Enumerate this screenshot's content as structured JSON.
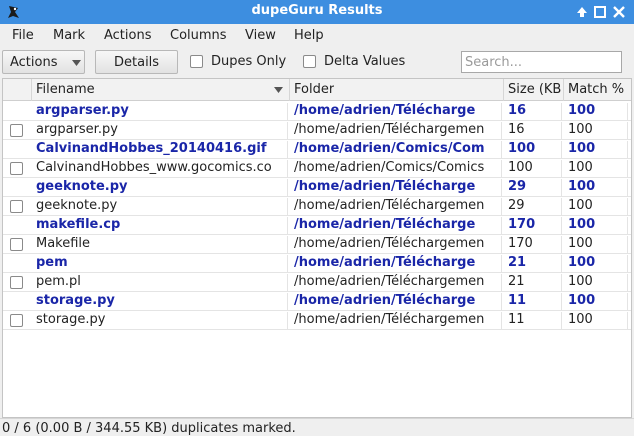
{
  "window": {
    "title": "dupeGuru Results"
  },
  "menu": [
    "File",
    "Mark",
    "Actions",
    "Columns",
    "View",
    "Help"
  ],
  "toolbar": {
    "actions_label": "Actions",
    "details_label": "Details",
    "dupes_only_label": "Dupes Only",
    "delta_values_label": "Delta Values",
    "search_placeholder": "Search..."
  },
  "table": {
    "columns": [
      "Filename",
      "Folder",
      "Size (KB",
      "Match %"
    ],
    "rows": [
      {
        "ref": true,
        "filename": "argparser.py",
        "folder": "/home/adrien/Télécharge",
        "size": "16",
        "match": "100"
      },
      {
        "ref": false,
        "filename": "argparser.py",
        "folder": "/home/adrien/Téléchargemen",
        "size": "16",
        "match": "100"
      },
      {
        "ref": true,
        "filename": "CalvinandHobbes_20140416.gif",
        "folder": "/home/adrien/Comics/Com",
        "size": "100",
        "match": "100"
      },
      {
        "ref": false,
        "filename": "CalvinandHobbes_www.gocomics.co",
        "folder": "/home/adrien/Comics/Comics",
        "size": "100",
        "match": "100"
      },
      {
        "ref": true,
        "filename": "geeknote.py",
        "folder": "/home/adrien/Télécharge",
        "size": "29",
        "match": "100"
      },
      {
        "ref": false,
        "filename": "geeknote.py",
        "folder": "/home/adrien/Téléchargemen",
        "size": "29",
        "match": "100"
      },
      {
        "ref": true,
        "filename": "makefile.cp",
        "folder": "/home/adrien/Télécharge",
        "size": "170",
        "match": "100"
      },
      {
        "ref": false,
        "filename": "Makefile",
        "folder": "/home/adrien/Téléchargemen",
        "size": "170",
        "match": "100"
      },
      {
        "ref": true,
        "filename": "pem",
        "folder": "/home/adrien/Télécharge",
        "size": "21",
        "match": "100"
      },
      {
        "ref": false,
        "filename": "pem.pl",
        "folder": "/home/adrien/Téléchargemen",
        "size": "21",
        "match": "100"
      },
      {
        "ref": true,
        "filename": "storage.py",
        "folder": "/home/adrien/Télécharge",
        "size": "11",
        "match": "100"
      },
      {
        "ref": false,
        "filename": "storage.py",
        "folder": "/home/adrien/Téléchargemen",
        "size": "11",
        "match": "100"
      }
    ]
  },
  "status": {
    "text": "0 / 6 (0.00 B / 344.55 KB) duplicates marked."
  },
  "colors": {
    "titlebar": "#3d8ee0",
    "reference_row_text": "#1a26a8"
  }
}
